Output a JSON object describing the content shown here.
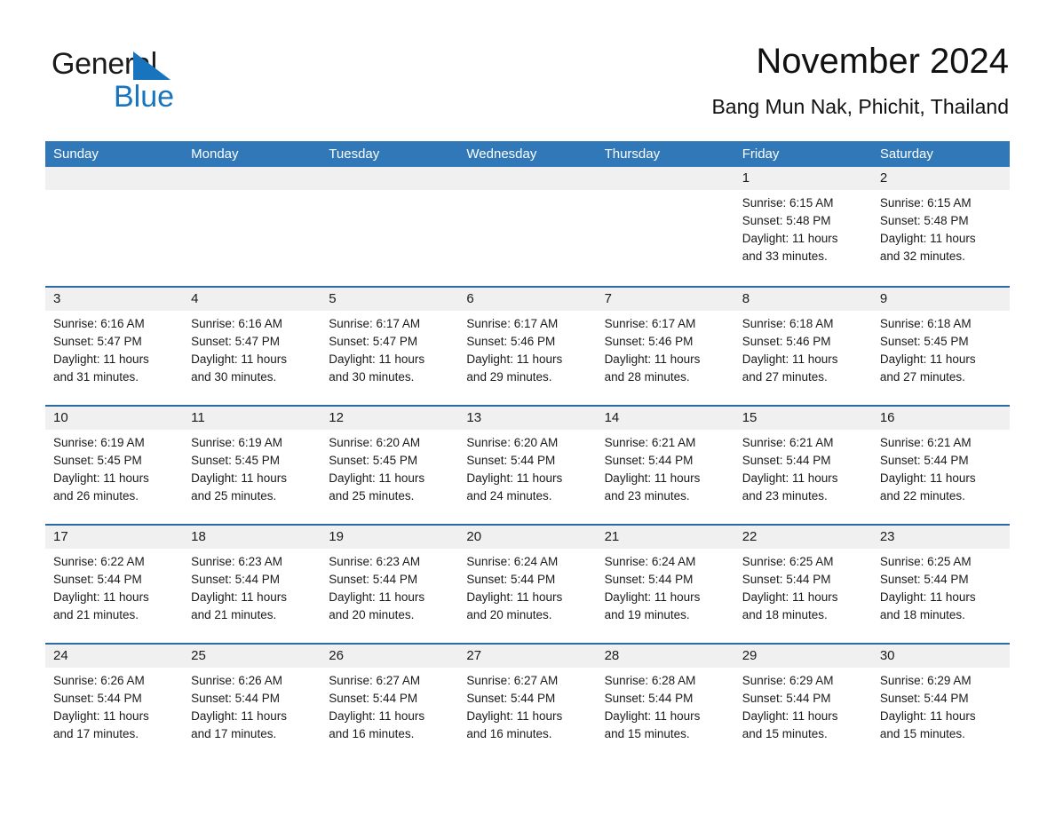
{
  "brand": {
    "name_part1": "General",
    "name_part2": "Blue",
    "accent_color": "#1874bd"
  },
  "header": {
    "title": "November 2024",
    "subtitle": "Bang Mun Nak, Phichit, Thailand"
  },
  "theme": {
    "header_bar_color": "#3078b8",
    "week_separator_color": "#2a6aa8",
    "day_band_color": "#f0f0f0"
  },
  "weekday_headers": [
    "Sunday",
    "Monday",
    "Tuesday",
    "Wednesday",
    "Thursday",
    "Friday",
    "Saturday"
  ],
  "labels": {
    "sunrise_prefix": "Sunrise:",
    "sunset_prefix": "Sunset:",
    "daylight_prefix": "Daylight:"
  },
  "weeks": [
    [
      {
        "day": "",
        "line1": "",
        "line2": "",
        "line3": "",
        "line4": ""
      },
      {
        "day": "",
        "line1": "",
        "line2": "",
        "line3": "",
        "line4": ""
      },
      {
        "day": "",
        "line1": "",
        "line2": "",
        "line3": "",
        "line4": ""
      },
      {
        "day": "",
        "line1": "",
        "line2": "",
        "line3": "",
        "line4": ""
      },
      {
        "day": "",
        "line1": "",
        "line2": "",
        "line3": "",
        "line4": ""
      },
      {
        "day": "1",
        "line1": "Sunrise: 6:15 AM",
        "line2": "Sunset: 5:48 PM",
        "line3": "Daylight: 11 hours",
        "line4": "and 33 minutes."
      },
      {
        "day": "2",
        "line1": "Sunrise: 6:15 AM",
        "line2": "Sunset: 5:48 PM",
        "line3": "Daylight: 11 hours",
        "line4": "and 32 minutes."
      }
    ],
    [
      {
        "day": "3",
        "line1": "Sunrise: 6:16 AM",
        "line2": "Sunset: 5:47 PM",
        "line3": "Daylight: 11 hours",
        "line4": "and 31 minutes."
      },
      {
        "day": "4",
        "line1": "Sunrise: 6:16 AM",
        "line2": "Sunset: 5:47 PM",
        "line3": "Daylight: 11 hours",
        "line4": "and 30 minutes."
      },
      {
        "day": "5",
        "line1": "Sunrise: 6:17 AM",
        "line2": "Sunset: 5:47 PM",
        "line3": "Daylight: 11 hours",
        "line4": "and 30 minutes."
      },
      {
        "day": "6",
        "line1": "Sunrise: 6:17 AM",
        "line2": "Sunset: 5:46 PM",
        "line3": "Daylight: 11 hours",
        "line4": "and 29 minutes."
      },
      {
        "day": "7",
        "line1": "Sunrise: 6:17 AM",
        "line2": "Sunset: 5:46 PM",
        "line3": "Daylight: 11 hours",
        "line4": "and 28 minutes."
      },
      {
        "day": "8",
        "line1": "Sunrise: 6:18 AM",
        "line2": "Sunset: 5:46 PM",
        "line3": "Daylight: 11 hours",
        "line4": "and 27 minutes."
      },
      {
        "day": "9",
        "line1": "Sunrise: 6:18 AM",
        "line2": "Sunset: 5:45 PM",
        "line3": "Daylight: 11 hours",
        "line4": "and 27 minutes."
      }
    ],
    [
      {
        "day": "10",
        "line1": "Sunrise: 6:19 AM",
        "line2": "Sunset: 5:45 PM",
        "line3": "Daylight: 11 hours",
        "line4": "and 26 minutes."
      },
      {
        "day": "11",
        "line1": "Sunrise: 6:19 AM",
        "line2": "Sunset: 5:45 PM",
        "line3": "Daylight: 11 hours",
        "line4": "and 25 minutes."
      },
      {
        "day": "12",
        "line1": "Sunrise: 6:20 AM",
        "line2": "Sunset: 5:45 PM",
        "line3": "Daylight: 11 hours",
        "line4": "and 25 minutes."
      },
      {
        "day": "13",
        "line1": "Sunrise: 6:20 AM",
        "line2": "Sunset: 5:44 PM",
        "line3": "Daylight: 11 hours",
        "line4": "and 24 minutes."
      },
      {
        "day": "14",
        "line1": "Sunrise: 6:21 AM",
        "line2": "Sunset: 5:44 PM",
        "line3": "Daylight: 11 hours",
        "line4": "and 23 minutes."
      },
      {
        "day": "15",
        "line1": "Sunrise: 6:21 AM",
        "line2": "Sunset: 5:44 PM",
        "line3": "Daylight: 11 hours",
        "line4": "and 23 minutes."
      },
      {
        "day": "16",
        "line1": "Sunrise: 6:21 AM",
        "line2": "Sunset: 5:44 PM",
        "line3": "Daylight: 11 hours",
        "line4": "and 22 minutes."
      }
    ],
    [
      {
        "day": "17",
        "line1": "Sunrise: 6:22 AM",
        "line2": "Sunset: 5:44 PM",
        "line3": "Daylight: 11 hours",
        "line4": "and 21 minutes."
      },
      {
        "day": "18",
        "line1": "Sunrise: 6:23 AM",
        "line2": "Sunset: 5:44 PM",
        "line3": "Daylight: 11 hours",
        "line4": "and 21 minutes."
      },
      {
        "day": "19",
        "line1": "Sunrise: 6:23 AM",
        "line2": "Sunset: 5:44 PM",
        "line3": "Daylight: 11 hours",
        "line4": "and 20 minutes."
      },
      {
        "day": "20",
        "line1": "Sunrise: 6:24 AM",
        "line2": "Sunset: 5:44 PM",
        "line3": "Daylight: 11 hours",
        "line4": "and 20 minutes."
      },
      {
        "day": "21",
        "line1": "Sunrise: 6:24 AM",
        "line2": "Sunset: 5:44 PM",
        "line3": "Daylight: 11 hours",
        "line4": "and 19 minutes."
      },
      {
        "day": "22",
        "line1": "Sunrise: 6:25 AM",
        "line2": "Sunset: 5:44 PM",
        "line3": "Daylight: 11 hours",
        "line4": "and 18 minutes."
      },
      {
        "day": "23",
        "line1": "Sunrise: 6:25 AM",
        "line2": "Sunset: 5:44 PM",
        "line3": "Daylight: 11 hours",
        "line4": "and 18 minutes."
      }
    ],
    [
      {
        "day": "24",
        "line1": "Sunrise: 6:26 AM",
        "line2": "Sunset: 5:44 PM",
        "line3": "Daylight: 11 hours",
        "line4": "and 17 minutes."
      },
      {
        "day": "25",
        "line1": "Sunrise: 6:26 AM",
        "line2": "Sunset: 5:44 PM",
        "line3": "Daylight: 11 hours",
        "line4": "and 17 minutes."
      },
      {
        "day": "26",
        "line1": "Sunrise: 6:27 AM",
        "line2": "Sunset: 5:44 PM",
        "line3": "Daylight: 11 hours",
        "line4": "and 16 minutes."
      },
      {
        "day": "27",
        "line1": "Sunrise: 6:27 AM",
        "line2": "Sunset: 5:44 PM",
        "line3": "Daylight: 11 hours",
        "line4": "and 16 minutes."
      },
      {
        "day": "28",
        "line1": "Sunrise: 6:28 AM",
        "line2": "Sunset: 5:44 PM",
        "line3": "Daylight: 11 hours",
        "line4": "and 15 minutes."
      },
      {
        "day": "29",
        "line1": "Sunrise: 6:29 AM",
        "line2": "Sunset: 5:44 PM",
        "line3": "Daylight: 11 hours",
        "line4": "and 15 minutes."
      },
      {
        "day": "30",
        "line1": "Sunrise: 6:29 AM",
        "line2": "Sunset: 5:44 PM",
        "line3": "Daylight: 11 hours",
        "line4": "and 15 minutes."
      }
    ]
  ]
}
